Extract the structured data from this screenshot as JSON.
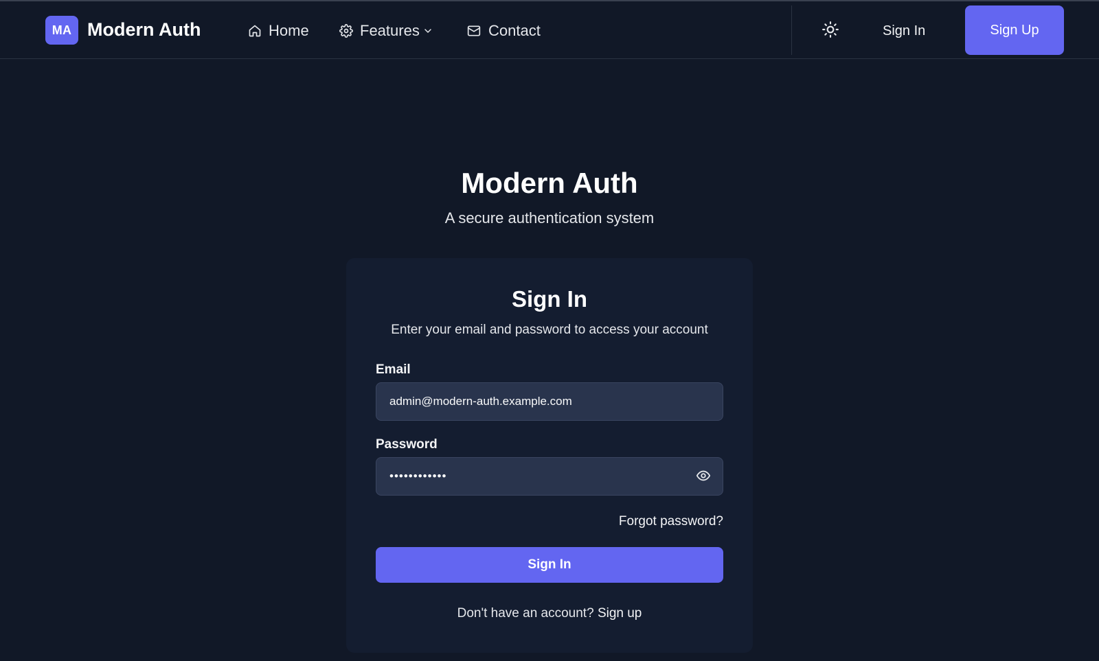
{
  "navbar": {
    "logo_initials": "MA",
    "brand": "Modern Auth",
    "links": [
      {
        "label": "Home",
        "icon": "home-icon"
      },
      {
        "label": "Features",
        "icon": "gear-icon",
        "has_dropdown": true
      },
      {
        "label": "Contact",
        "icon": "mail-icon"
      }
    ],
    "theme_toggle_icon": "sun-icon",
    "sign_in_label": "Sign In",
    "sign_up_label": "Sign Up"
  },
  "hero": {
    "title": "Modern Auth",
    "subtitle": "A secure authentication system"
  },
  "login_card": {
    "title": "Sign In",
    "description": "Enter your email and password to access your account",
    "email": {
      "label": "Email",
      "value": "admin@modern-auth.example.com"
    },
    "password": {
      "label": "Password",
      "value": "••••••••••••",
      "visibility_icon": "eye-icon"
    },
    "forgot_password": "Forgot password?",
    "submit_label": "Sign In",
    "no_account_text": "Don't have an account?",
    "sign_up_link": "Sign up"
  },
  "colors": {
    "background": "#111827",
    "card": "#141d30",
    "input": "#29344d",
    "accent": "#6366f1",
    "text": "#f9fafb"
  }
}
